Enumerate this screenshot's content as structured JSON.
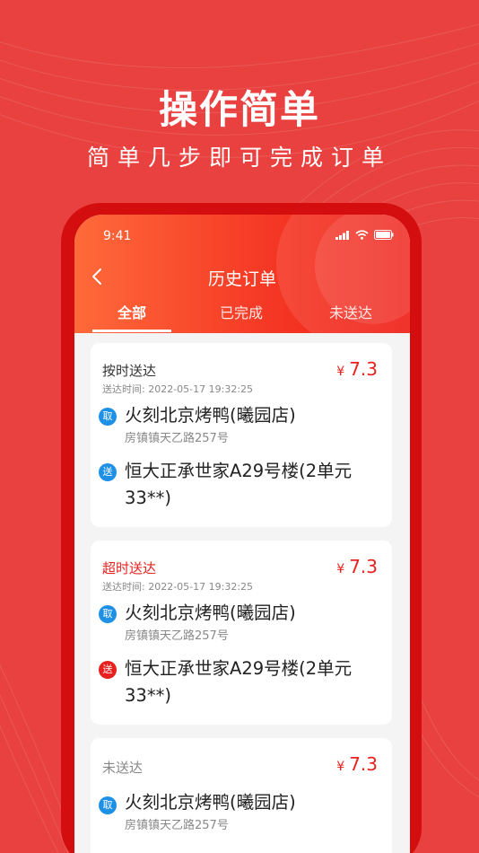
{
  "promo": {
    "title": "操作简单",
    "subtitle": "简单几步即可完成订单"
  },
  "status_bar": {
    "time": "9:41"
  },
  "nav": {
    "title": "历史订单"
  },
  "tabs": [
    {
      "label": "全部",
      "active": true
    },
    {
      "label": "已完成",
      "active": false
    },
    {
      "label": "未送达",
      "active": false
    }
  ],
  "orders": [
    {
      "status": "按时送达",
      "currency": "¥",
      "price": "7.3",
      "delivery_time": "送达时间: 2022-05-17  19:32:25",
      "pickup": {
        "badge": "取",
        "name": "火刻北京烤鸭(曦园店)",
        "address": "房镇镇天乙路257号"
      },
      "dropoff": {
        "badge": "送",
        "name": "恒大正承世家A29号楼(2单元33**)"
      }
    },
    {
      "status": "超时送达",
      "currency": "¥",
      "price": "7.3",
      "delivery_time": "送达时间: 2022-05-17  19:32:25",
      "pickup": {
        "badge": "取",
        "name": "火刻北京烤鸭(曦园店)",
        "address": "房镇镇天乙路257号"
      },
      "dropoff": {
        "badge": "送",
        "name": "恒大正承世家A29号楼(2单元33**)"
      }
    },
    {
      "status": "未送达",
      "currency": "¥",
      "price": "7.3",
      "pickup": {
        "badge": "取",
        "name": "火刻北京烤鸭(曦园店)",
        "address": "房镇镇天乙路257号"
      }
    }
  ],
  "colors": {
    "background": "#e8413f",
    "accent_red": "#e8211e",
    "pickup_blue": "#1e90e6"
  },
  "icons": [
    "back-icon",
    "signal-icon",
    "wifi-icon",
    "battery-icon"
  ]
}
